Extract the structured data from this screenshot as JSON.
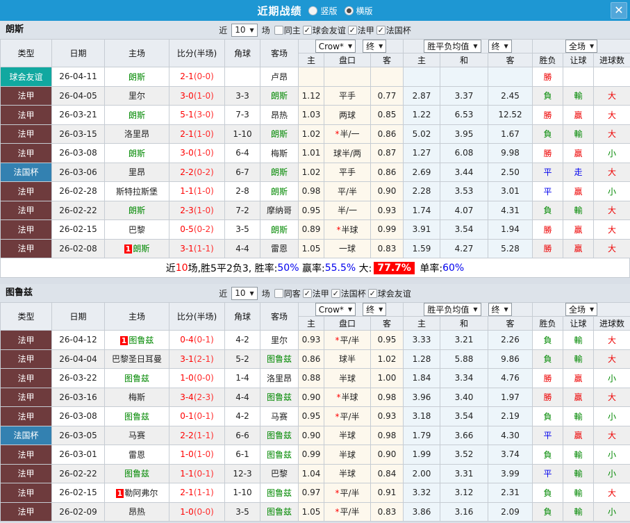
{
  "titlebar": {
    "title": "近期战绩",
    "radios": [
      {
        "label": "竖版",
        "selected": false
      },
      {
        "label": "横版",
        "selected": true
      }
    ],
    "close_glyph": "✕"
  },
  "badge": "1",
  "colors": {
    "accent_blue": "#1e97d3",
    "league": {
      "球会友谊": "#11a8a0",
      "法甲": "#6e3b3d",
      "法国杯": "#3381b1"
    },
    "result": {
      "勝": "#ee0000",
      "贏": "#ee0000",
      "大": "#ee0000",
      "負": "#008800",
      "輸": "#008800",
      "小": "#008800",
      "平": "#0000ee",
      "走": "#0000ee"
    },
    "team_green": "#008800",
    "score_red": "#ff0000"
  },
  "table": {
    "cols": [
      "类型",
      "日期",
      "主场",
      "比分(半场)",
      "角球",
      "客场"
    ],
    "odds_provider": "Crow*",
    "odds_state": "终",
    "avg_label": "胜平负均值",
    "avg_state": "终",
    "scope_label": "全场",
    "sub": [
      "主",
      "盘口",
      "客",
      "主",
      "和",
      "客",
      "胜负",
      "让球",
      "进球数"
    ]
  },
  "sections": [
    {
      "team": "朗斯",
      "filter": {
        "prefix": "近",
        "count": "10",
        "suffix": "场",
        "items": [
          {
            "label": "同主",
            "checked": false
          },
          {
            "label": "球会友谊",
            "checked": true
          },
          {
            "label": "法甲",
            "checked": true
          },
          {
            "label": "法国杯",
            "checked": true
          }
        ]
      },
      "rows": [
        {
          "lg": "球会友谊",
          "dt": "26-04-11",
          "hm": "朗斯",
          "hmG": true,
          "hmB": false,
          "sc": "2-1",
          "hf": "(0-0)",
          "cn": "",
          "aw": "卢昂",
          "awG": false,
          "o1": "",
          "st": false,
          "pk": "",
          "o2": "",
          "a1": "",
          "a2": "",
          "a3": "",
          "r1": "勝",
          "r2": "",
          "r3": ""
        },
        {
          "lg": "法甲",
          "dt": "26-04-05",
          "hm": "里尔",
          "hmG": false,
          "hmB": false,
          "sc": "3-0",
          "hf": "(1-0)",
          "cn": "3-3",
          "aw": "朗斯",
          "awG": true,
          "o1": "1.12",
          "st": false,
          "pk": "平手",
          "o2": "0.77",
          "a1": "2.87",
          "a2": "3.37",
          "a3": "2.45",
          "r1": "負",
          "r2": "輸",
          "r3": "大"
        },
        {
          "lg": "法甲",
          "dt": "26-03-21",
          "hm": "朗斯",
          "hmG": true,
          "hmB": false,
          "sc": "5-1",
          "hf": "(3-0)",
          "cn": "7-3",
          "aw": "昂热",
          "awG": false,
          "o1": "1.03",
          "st": false,
          "pk": "两球",
          "o2": "0.85",
          "a1": "1.22",
          "a2": "6.53",
          "a3": "12.52",
          "r1": "勝",
          "r2": "贏",
          "r3": "大"
        },
        {
          "lg": "法甲",
          "dt": "26-03-15",
          "hm": "洛里昂",
          "hmG": false,
          "hmB": false,
          "sc": "2-1",
          "hf": "(1-0)",
          "cn": "1-10",
          "aw": "朗斯",
          "awG": true,
          "o1": "1.02",
          "st": true,
          "pk": "半/一",
          "o2": "0.86",
          "a1": "5.02",
          "a2": "3.95",
          "a3": "1.67",
          "r1": "負",
          "r2": "輸",
          "r3": "大"
        },
        {
          "lg": "法甲",
          "dt": "26-03-08",
          "hm": "朗斯",
          "hmG": true,
          "hmB": false,
          "sc": "3-0",
          "hf": "(1-0)",
          "cn": "6-4",
          "aw": "梅斯",
          "awG": false,
          "o1": "1.01",
          "st": false,
          "pk": "球半/两",
          "o2": "0.87",
          "a1": "1.27",
          "a2": "6.08",
          "a3": "9.98",
          "r1": "勝",
          "r2": "贏",
          "r3": "小"
        },
        {
          "lg": "法国杯",
          "dt": "26-03-06",
          "hm": "里昂",
          "hmG": false,
          "hmB": false,
          "sc": "2-2",
          "hf": "(0-2)",
          "cn": "6-7",
          "aw": "朗斯",
          "awG": true,
          "o1": "1.02",
          "st": false,
          "pk": "平手",
          "o2": "0.86",
          "a1": "2.69",
          "a2": "3.44",
          "a3": "2.50",
          "r1": "平",
          "r2": "走",
          "r3": "大"
        },
        {
          "lg": "法甲",
          "dt": "26-02-28",
          "hm": "斯特拉斯堡",
          "hmG": false,
          "hmB": false,
          "sc": "1-1",
          "hf": "(1-0)",
          "cn": "2-8",
          "aw": "朗斯",
          "awG": true,
          "o1": "0.98",
          "st": false,
          "pk": "平/半",
          "o2": "0.90",
          "a1": "2.28",
          "a2": "3.53",
          "a3": "3.01",
          "r1": "平",
          "r2": "贏",
          "r3": "小"
        },
        {
          "lg": "法甲",
          "dt": "26-02-22",
          "hm": "朗斯",
          "hmG": true,
          "hmB": false,
          "sc": "2-3",
          "hf": "(1-0)",
          "cn": "7-2",
          "aw": "摩纳哥",
          "awG": false,
          "o1": "0.95",
          "st": false,
          "pk": "半/一",
          "o2": "0.93",
          "a1": "1.74",
          "a2": "4.07",
          "a3": "4.31",
          "r1": "負",
          "r2": "輸",
          "r3": "大"
        },
        {
          "lg": "法甲",
          "dt": "26-02-15",
          "hm": "巴黎",
          "hmG": false,
          "hmB": false,
          "sc": "0-5",
          "hf": "(0-2)",
          "cn": "3-5",
          "aw": "朗斯",
          "awG": true,
          "o1": "0.89",
          "st": true,
          "pk": "半球",
          "o2": "0.99",
          "a1": "3.91",
          "a2": "3.54",
          "a3": "1.94",
          "r1": "勝",
          "r2": "贏",
          "r3": "大"
        },
        {
          "lg": "法甲",
          "dt": "26-02-08",
          "hm": "朗斯",
          "hmG": true,
          "hmB": true,
          "sc": "3-1",
          "hf": "(1-1)",
          "cn": "4-4",
          "aw": "雷恩",
          "awG": false,
          "o1": "1.05",
          "st": false,
          "pk": "一球",
          "o2": "0.83",
          "a1": "1.59",
          "a2": "4.27",
          "a3": "5.28",
          "r1": "勝",
          "r2": "贏",
          "r3": "大"
        }
      ],
      "summary": [
        {
          "t": "近",
          "s": "k"
        },
        {
          "t": "10",
          "s": "r"
        },
        {
          "t": "场,胜5平2负3, 胜率:",
          "s": "k"
        },
        {
          "t": "50%",
          "s": "b"
        },
        {
          "t": " 赢率:",
          "s": "k"
        },
        {
          "t": "55.5%",
          "s": "b"
        },
        {
          "t": " 大:",
          "s": "k"
        },
        {
          "t": "77.7%",
          "s": "hl"
        },
        {
          "t": " 单率:",
          "s": "k"
        },
        {
          "t": "60%",
          "s": "b"
        }
      ]
    },
    {
      "team": "图鲁兹",
      "filter": {
        "prefix": "近",
        "count": "10",
        "suffix": "场",
        "items": [
          {
            "label": "同客",
            "checked": false
          },
          {
            "label": "法甲",
            "checked": true
          },
          {
            "label": "法国杯",
            "checked": true
          },
          {
            "label": "球会友谊",
            "checked": true
          }
        ]
      },
      "rows": [
        {
          "lg": "法甲",
          "dt": "26-04-12",
          "hm": "图鲁兹",
          "hmG": true,
          "hmB": true,
          "sc": "0-4",
          "hf": "(0-1)",
          "cn": "4-2",
          "aw": "里尔",
          "awG": false,
          "o1": "0.93",
          "st": true,
          "pk": "平/半",
          "o2": "0.95",
          "a1": "3.33",
          "a2": "3.21",
          "a3": "2.26",
          "r1": "負",
          "r2": "輸",
          "r3": "大"
        },
        {
          "lg": "法甲",
          "dt": "26-04-04",
          "hm": "巴黎圣日耳曼",
          "hmG": false,
          "hmB": false,
          "sc": "3-1",
          "hf": "(2-1)",
          "cn": "5-2",
          "aw": "图鲁兹",
          "awG": true,
          "o1": "0.86",
          "st": false,
          "pk": "球半",
          "o2": "1.02",
          "a1": "1.28",
          "a2": "5.88",
          "a3": "9.86",
          "r1": "負",
          "r2": "輸",
          "r3": "大"
        },
        {
          "lg": "法甲",
          "dt": "26-03-22",
          "hm": "图鲁兹",
          "hmG": true,
          "hmB": false,
          "sc": "1-0",
          "hf": "(0-0)",
          "cn": "1-4",
          "aw": "洛里昂",
          "awG": false,
          "o1": "0.88",
          "st": false,
          "pk": "半球",
          "o2": "1.00",
          "a1": "1.84",
          "a2": "3.34",
          "a3": "4.76",
          "r1": "勝",
          "r2": "贏",
          "r3": "小"
        },
        {
          "lg": "法甲",
          "dt": "26-03-16",
          "hm": "梅斯",
          "hmG": false,
          "hmB": false,
          "sc": "3-4",
          "hf": "(2-3)",
          "cn": "4-4",
          "aw": "图鲁兹",
          "awG": true,
          "o1": "0.90",
          "st": true,
          "pk": "半球",
          "o2": "0.98",
          "a1": "3.96",
          "a2": "3.40",
          "a3": "1.97",
          "r1": "勝",
          "r2": "贏",
          "r3": "大"
        },
        {
          "lg": "法甲",
          "dt": "26-03-08",
          "hm": "图鲁兹",
          "hmG": true,
          "hmB": false,
          "sc": "0-1",
          "hf": "(0-1)",
          "cn": "4-2",
          "aw": "马赛",
          "awG": false,
          "o1": "0.95",
          "st": true,
          "pk": "平/半",
          "o2": "0.93",
          "a1": "3.18",
          "a2": "3.54",
          "a3": "2.19",
          "r1": "負",
          "r2": "輸",
          "r3": "小"
        },
        {
          "lg": "法国杯",
          "dt": "26-03-05",
          "hm": "马赛",
          "hmG": false,
          "hmB": false,
          "sc": "2-2",
          "hf": "(1-1)",
          "cn": "6-6",
          "aw": "图鲁兹",
          "awG": true,
          "o1": "0.90",
          "st": false,
          "pk": "半球",
          "o2": "0.98",
          "a1": "1.79",
          "a2": "3.66",
          "a3": "4.30",
          "r1": "平",
          "r2": "贏",
          "r3": "大"
        },
        {
          "lg": "法甲",
          "dt": "26-03-01",
          "hm": "雷恩",
          "hmG": false,
          "hmB": false,
          "sc": "1-0",
          "hf": "(1-0)",
          "cn": "6-1",
          "aw": "图鲁兹",
          "awG": true,
          "o1": "0.99",
          "st": false,
          "pk": "半球",
          "o2": "0.90",
          "a1": "1.99",
          "a2": "3.52",
          "a3": "3.74",
          "r1": "負",
          "r2": "輸",
          "r3": "小"
        },
        {
          "lg": "法甲",
          "dt": "26-02-22",
          "hm": "图鲁兹",
          "hmG": true,
          "hmB": false,
          "sc": "1-1",
          "hf": "(0-1)",
          "cn": "12-3",
          "aw": "巴黎",
          "awG": false,
          "o1": "1.04",
          "st": false,
          "pk": "半球",
          "o2": "0.84",
          "a1": "2.00",
          "a2": "3.31",
          "a3": "3.99",
          "r1": "平",
          "r2": "輸",
          "r3": "小"
        },
        {
          "lg": "法甲",
          "dt": "26-02-15",
          "hm": "勒阿弗尔",
          "hmG": false,
          "hmB": true,
          "sc": "2-1",
          "hf": "(1-1)",
          "cn": "1-10",
          "aw": "图鲁兹",
          "awG": true,
          "o1": "0.97",
          "st": true,
          "pk": "平/半",
          "o2": "0.91",
          "a1": "3.32",
          "a2": "3.12",
          "a3": "2.31",
          "r1": "負",
          "r2": "輸",
          "r3": "大"
        },
        {
          "lg": "法甲",
          "dt": "26-02-09",
          "hm": "昂热",
          "hmG": false,
          "hmB": false,
          "sc": "1-0",
          "hf": "(0-0)",
          "cn": "3-5",
          "aw": "图鲁兹",
          "awG": true,
          "o1": "1.05",
          "st": true,
          "pk": "平/半",
          "o2": "0.83",
          "a1": "3.86",
          "a2": "3.16",
          "a3": "2.09",
          "r1": "負",
          "r2": "輸",
          "r3": "小"
        }
      ],
      "summary": null
    }
  ]
}
